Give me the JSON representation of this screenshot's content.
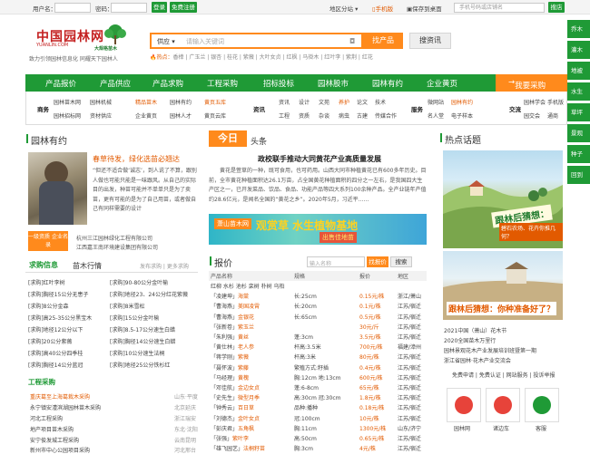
{
  "topbar": {
    "user_label": "用户名：",
    "pass_label": "密码：",
    "login": "登录",
    "register": "免费注册",
    "site": "地区分站",
    "mobile": "手机版",
    "save": "保存到桌面",
    "search_user": "手机号码或店铺名",
    "search_btn": "搜店"
  },
  "logo": {
    "name": "中国园林网",
    "domain": "YUANLIN.COM",
    "slogan": "致力引领园林信息化 同耀天下园林人",
    "brand2": "大规格苗木"
  },
  "search": {
    "select": "供应",
    "placeholder": "请输入关键词",
    "find_btn": "找产品",
    "info_btn": "搜资讯"
  },
  "hot": {
    "label": "热点：",
    "items": "香樟 | 广玉兰 | 银杏 | 桂花 | 紫薇 | 大叶女贞 | 红枫 | 马褂木 | 红叶李 | 紫荆 | 红花"
  },
  "right_nav": [
    "乔木",
    "灌木",
    "地被",
    "水生",
    "草坪",
    "景观",
    "种子",
    "回到"
  ],
  "main_nav": [
    "产品报价",
    "产品供应",
    "产品求购",
    "工程采购",
    "招标投标",
    "园林股市",
    "园林有约",
    "企业黄页"
  ],
  "main_nav_buy": "我要采购",
  "subnav": {
    "g1": {
      "title": "商务",
      "items": [
        "园林苗木网",
        "园林招标网",
        "园林机械",
        "资材供应"
      ]
    },
    "g2": {
      "items": [
        "精品苗木",
        "企业黄页",
        "园林人才",
        "园林有约"
      ]
    },
    "g3": {
      "items": [
        "黄页五库",
        "黄页云库"
      ]
    },
    "g4": {
      "title": "资讯",
      "items": [
        "资讯",
        "工程",
        "设计",
        "资质",
        "文苑",
        "杂谈",
        "养护",
        "病虫",
        "论文",
        "古建",
        "技术",
        "传媒合作"
      ]
    },
    "g5": {
      "title": "服务",
      "items": [
        "微网站",
        "名人堂",
        "园林有约",
        "电子样本"
      ]
    },
    "g6": {
      "title": "交流",
      "items": [
        "园林学会",
        "手机版",
        "园交会",
        "通商",
        "百科"
      ]
    }
  },
  "col1": {
    "title": "园林有约",
    "quote_title": "春草待发，绿化选苗必翘达",
    "quote": "“但还不适合做‘诚志’，到人说了不算，跟别人做也可能只能是一味跟风。从自己的实际目的出发，种苗可能并不单单只是为了卖苗，更有可能的是为了自己用苗，或者做自己有同样需要的设计",
    "badge": "一级资质 企业名录",
    "companies": [
      "杭州三江园林绿化工程有限公司",
      "江西嘉王南环境建设集团有限公司"
    ],
    "tabs": {
      "a": "求购信息",
      "b": "苗木行情",
      "more": "发布求购 | 更多求购"
    },
    "list_left": [
      "[求购]红叶李树",
      "[求购]胸径15公分无患子",
      "[求购]8公分金森",
      "[求购]高25-35公分黑宝木",
      "[求购]地径12公分以下",
      "[求购]20公分紫薇",
      "[求购]高40公分四季桂",
      "[求购]胸径14公分蓝冠"
    ],
    "list_right": [
      "[求购]90-80公分金叶榆",
      "[求购]地径23、24公分红花紫薇",
      "[求购]8米雪松",
      "[求购]15公分金叶榆",
      "[求购]8.5-17公分速生白蜡",
      "[求购]胸径14公分速生白蜡",
      "[求购]10公分速生法桐",
      "[求购]地径25公分铁杉红"
    ],
    "ops_title": "工程采购",
    "ops": [
      {
        "name": "重庆葛至上海葛栽木采购",
        "loc": "山东·平度"
      },
      {
        "name": "永宁镇安澧滨湖园林苗木采购",
        "loc": "北京延庆"
      },
      {
        "name": "河北工程采购",
        "loc": "浙江瑞安"
      },
      {
        "name": "地产项目苗木采购",
        "loc": "东北·沈阳"
      },
      {
        "name": "安宁俊发城工程采购",
        "loc": "云南昆明"
      },
      {
        "name": "新州市中心公园项目采购",
        "loc": "河北邢台"
      }
    ]
  },
  "col2": {
    "today": "今日",
    "today_sub": "头条",
    "headline": "政校联手推动大同黄花产业高质量发展",
    "para": "黄花是萱草的一种，既可食用，也可药用。山西大同市种植黄花已有600多年历史。目前，全市黄花种植面积达26.1万亩，占全国黄花种植面积的四分之一左右，是我国四大生产区之一，已开发菜品、饮品、食品、功能产品等四大系列100余种产品。全产业链年产值约28.6亿元，是闻名全国的“黄花之乡”。2020年5月，习近平……",
    "banner": {
      "g1": "萧山苗木网",
      "g2": "观赏草 水生植物基地",
      "g3": "出售佳地苗"
    },
    "quote_title": "报价",
    "quote_input": "输入名称",
    "btn_quote": "找报价",
    "btn_search": "搜索",
    "headers": [
      "产品名称",
      "规格",
      "报价",
      "地区"
    ],
    "subhead": "红柳 水杉 池杉 栾树 朴树 乌桕",
    "rows": [
      {
        "name": "「凌建坤」",
        "prod": "海棠",
        "spec": "长:25cm",
        "price": "0.15元/株",
        "loc": "浙江/萧山"
      },
      {
        "name": "「曹海燕」",
        "prod": "美国凌霄",
        "spec": "长:20cm",
        "price": "0.1元/株",
        "loc": "江苏/宿迁"
      },
      {
        "name": "「曹海燕」",
        "prod": "金银花",
        "spec": "长:65cm",
        "price": "0.5元/株",
        "loc": "江苏/宿迁"
      },
      {
        "name": "「张新卷」",
        "prod": "紫玉兰",
        "spec": "",
        "price": "30元/斤",
        "loc": "江苏/宿迁"
      },
      {
        "name": "「朱利强」",
        "prod": "黄丝",
        "spec": "蓬:3cm",
        "price": "3.5元/株",
        "loc": "江苏/宿迁"
      },
      {
        "name": "「黄仕林」",
        "prod": "老人参",
        "spec": "杆高:3.5米",
        "price": "700元/株",
        "loc": "福建/漳州"
      },
      {
        "name": "「蒋学刚」",
        "prod": "紫薇",
        "spec": "杆高:3米",
        "price": "80元/株",
        "loc": "江苏/宿迁"
      },
      {
        "name": "「聂怀波」",
        "prod": "紫藤",
        "spec": "繁殖方式:籽插",
        "price": "0.4元/株",
        "loc": "江苏/宿迁"
      },
      {
        "name": "「马经理」",
        "prod": "黄槐",
        "spec": "胸:12cm 地:13cm",
        "price": "600元/株",
        "loc": "江苏/宿迁"
      },
      {
        "name": "「邓佳航」",
        "prod": "金边女贞",
        "spec": "蓬:6-8cm",
        "price": "65元/株",
        "loc": "江苏/宿迁"
      },
      {
        "name": "「史先生」",
        "prod": "微型月季",
        "spec": "高:30cm 冠:30cm",
        "price": "1.8元/株",
        "loc": "江苏/宿迁"
      },
      {
        "name": "「钟秀云」",
        "prod": "百日草",
        "spec": "品种:播种",
        "price": "0.18元/株",
        "loc": "江苏/宿迁"
      },
      {
        "name": "「刘德杰」",
        "prod": "金叶女贞",
        "spec": "冠:100cm",
        "price": "10元/株",
        "loc": "江苏/宿迁"
      },
      {
        "name": "「彭庆君」",
        "prod": "五角枫",
        "spec": "胸:11cm",
        "price": "1300元/株",
        "loc": "山东/济宁"
      },
      {
        "name": "「张强」",
        "prod": "紫叶李",
        "spec": "高:50cm",
        "price": "0.65元/株",
        "loc": "江苏/宿迁"
      },
      {
        "name": "「雄飞园艺」",
        "prod": "法桐籽苗",
        "spec": "胸:3cm",
        "price": "4元/株",
        "loc": "江苏/宿迁"
      }
    ]
  },
  "col3": {
    "title": "热点话题",
    "pic1_cap": "跟林后猜想：",
    "pic1_cap2": "碧石农场、花卉你推几何？",
    "pic2_cap": "跟林后猜想：你种准备好了？",
    "news": [
      "2021中国（萧山）花木节",
      "2020全国苗木万里行",
      "园林景观花木产业发展培训班暨第一期",
      "浙江省园林·花木产业交流会"
    ],
    "links": "免费申请 | 免费认证 | 网站服务 | 投诉举报",
    "qr_labels": [
      "园林网",
      "诸边车",
      "客服"
    ]
  }
}
